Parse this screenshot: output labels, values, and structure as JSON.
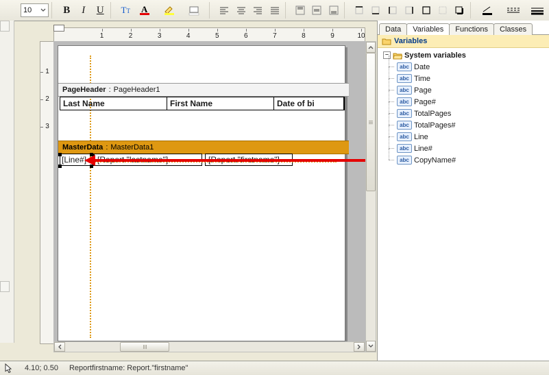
{
  "toolbar": {
    "font_size": "10"
  },
  "ruler": {
    "marks": [
      "1",
      "2",
      "3",
      "4",
      "5",
      "6",
      "7",
      "8",
      "9",
      "10"
    ]
  },
  "vruler": {
    "marks": [
      "1",
      "2",
      "3"
    ]
  },
  "page": {
    "header_band": {
      "label": "PageHeader",
      "name": "PageHeader1"
    },
    "columns": {
      "c1": "Last Name",
      "c2": "First Name",
      "c3": "Date of bi"
    },
    "master_band": {
      "label": "MasterData",
      "name": "MasterData1"
    },
    "row": {
      "line": "[Line#]",
      "f2": "[Report.\"lastname\"]",
      "f3": "[Report.\"firstname\"]"
    }
  },
  "rpane": {
    "tabs": [
      "Data",
      "Variables",
      "Functions",
      "Classes"
    ],
    "active_tab_index": 1,
    "title": "Variables",
    "system_label": "System variables",
    "vars": [
      "Date",
      "Time",
      "Page",
      "Page#",
      "TotalPages",
      "TotalPages#",
      "Line",
      "Line#",
      "CopyName#"
    ]
  },
  "status": {
    "hint_icon": "cursor",
    "pos": "4.10; 0.50",
    "selection": "Reportfirstname: Report.\"firstname\""
  }
}
